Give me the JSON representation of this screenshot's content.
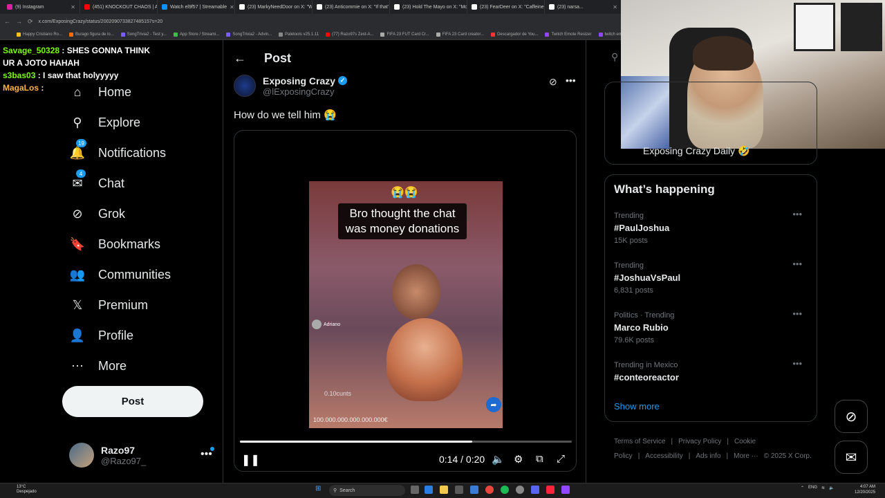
{
  "browser": {
    "tabs": [
      {
        "title": "(9) Instagram",
        "color": "#d6249f"
      },
      {
        "title": "(451) KNOCKOUT CHAOS | Anti",
        "color": "#ff0000"
      },
      {
        "title": "Watch el9f57 | Streamable",
        "color": "#0f90fa"
      },
      {
        "title": "(23) MarkyNeedDoor on X: \"Wi",
        "color": "#ffffff"
      },
      {
        "title": "(23) Anticommie on X: \"If that'",
        "color": "#ffffff"
      },
      {
        "title": "(23) Hold The Mayo on X: \"Mo",
        "color": "#ffffff"
      },
      {
        "title": "(23) FearDeer on X: \"Caffeine g",
        "color": "#ffffff"
      },
      {
        "title": "(23) narsa...",
        "color": "#ffffff"
      }
    ],
    "url": "x.com/ExposingCrazy/status/2002090733827485157s=20",
    "bookmarks": [
      {
        "label": "Happy Cristiano Ro...",
        "color": "#f5c518"
      },
      {
        "label": "Burago figura de lo...",
        "color": "#ff6a00"
      },
      {
        "label": "SongTrivia2 - Test y...",
        "color": "#7b5cff"
      },
      {
        "label": "App Store / Streami...",
        "color": "#3fbf3f"
      },
      {
        "label": "SongTrivia2 - Advin...",
        "color": "#7b5cff"
      },
      {
        "label": "Paletools v25.1.11",
        "color": "#888888"
      },
      {
        "label": "(77) Razo97s Zest-A...",
        "color": "#ff0000"
      },
      {
        "label": "FIFA 23 FUT Card Cr...",
        "color": "#aaaaaa"
      },
      {
        "label": "FIFA 23 Card creator...",
        "color": "#aaaaaa"
      },
      {
        "label": "Descargador de You...",
        "color": "#ff3333"
      },
      {
        "label": "Twitch Emote Resizer",
        "color": "#9146ff"
      },
      {
        "label": "twitch em",
        "color": "#9146ff"
      }
    ]
  },
  "chat": [
    {
      "user": "Savage_50328",
      "user_color": "#7cfc00",
      "message": "SHES GONNA THINK UR A JOTO HAHAH"
    },
    {
      "user": "s3bas03",
      "user_color": "#7cfc00",
      "message": "I saw that holyyyyy"
    },
    {
      "user": "MagaLos",
      "user_color": "#ffb347",
      "message": ""
    }
  ],
  "nav": {
    "items": [
      {
        "label": "Home",
        "icon": "home-icon",
        "glyph": "⌂"
      },
      {
        "label": "Explore",
        "icon": "search-icon",
        "glyph": "⚲"
      },
      {
        "label": "Notifications",
        "icon": "bell-icon",
        "glyph": "🔔",
        "badge": "19"
      },
      {
        "label": "Chat",
        "icon": "mail-icon",
        "glyph": "✉",
        "badge": "4"
      },
      {
        "label": "Grok",
        "icon": "grok-icon",
        "glyph": "⊘"
      },
      {
        "label": "Bookmarks",
        "icon": "bookmark-icon",
        "glyph": "🔖"
      },
      {
        "label": "Communities",
        "icon": "communities-icon",
        "glyph": "👥"
      },
      {
        "label": "Premium",
        "icon": "x-logo-icon",
        "glyph": "𝕏"
      },
      {
        "label": "Profile",
        "icon": "profile-icon",
        "glyph": "👤"
      },
      {
        "label": "More",
        "icon": "more-circle-icon",
        "glyph": "⋯"
      }
    ],
    "post_button": "Post",
    "account": {
      "name": "Razo97",
      "handle": "@Razo97_"
    }
  },
  "post": {
    "header_title": "Post",
    "author_name": "Exposing Crazy",
    "author_handle": "@lExposingCrazy",
    "text": "How do we tell him 😭",
    "video": {
      "caption": "Bro thought the chat was money donations",
      "emoji_top": "😭😭",
      "tag_name": "Adriano",
      "cents_text": "0.10cunts",
      "money_text": "100.000.000.000.000.000€",
      "current_time": "0:14",
      "duration": "0:20",
      "time_label": "0:14 / 0:20",
      "progress": 0.7
    }
  },
  "right": {
    "card_label": "Exposing Crazy Daily 🤣",
    "whats_happening": "What’s happening",
    "trends": [
      {
        "meta": "Trending",
        "name": "#PaulJoshua",
        "count": "15K posts"
      },
      {
        "meta": "Trending",
        "name": "#JoshuaVsPaul",
        "count": "6,831 posts"
      },
      {
        "meta": "Politics · Trending",
        "name": "Marco Rubio",
        "count": "79.6K posts"
      },
      {
        "meta": "Trending in Mexico",
        "name": "#conteoreactor",
        "count": ""
      }
    ],
    "show_more": "Show more",
    "footer": [
      "Terms of Service",
      "|",
      "Privacy Policy",
      "|",
      "Cookie Policy",
      "|",
      "Accessibility",
      "|",
      "Ads info",
      "|",
      "More ···",
      "© 2025 X Corp."
    ]
  },
  "taskbar": {
    "weather_temp": "13°C",
    "weather_desc": "Despejado",
    "search": "Search",
    "lang": "ENG",
    "time": "4:07 AM",
    "date": "12/20/2025"
  },
  "colors": {
    "accent": "#1d9bf0",
    "bg": "#000000",
    "border": "#2f3336",
    "muted": "#71767b"
  }
}
